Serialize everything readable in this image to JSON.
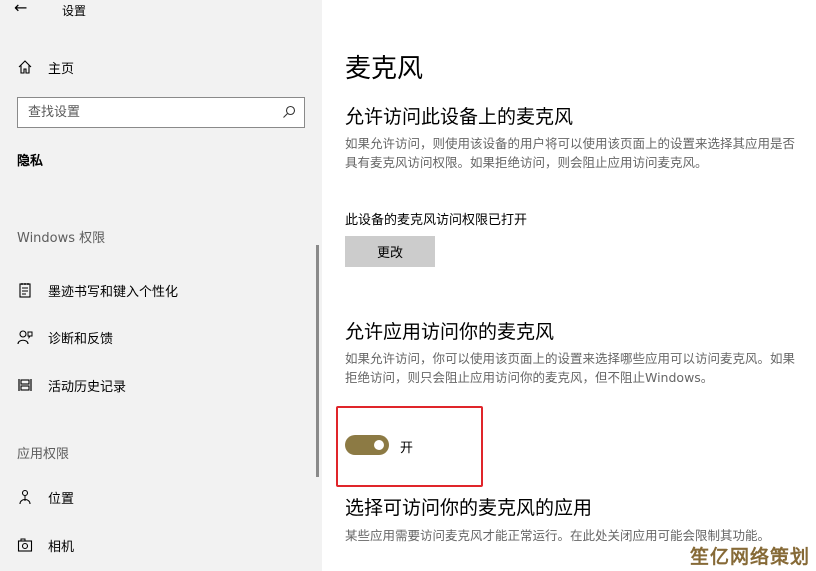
{
  "app": {
    "title": "设置"
  },
  "sidebar": {
    "home_label": "主页",
    "search_placeholder": "查找设置",
    "current_section": "隐私",
    "groups": [
      {
        "header": "Windows 权限",
        "items": [
          {
            "label": "墨迹书写和键入个性化",
            "icon": "notepad-icon"
          },
          {
            "label": "诊断和反馈",
            "icon": "person-feedback-icon"
          },
          {
            "label": "活动历史记录",
            "icon": "timeline-icon"
          }
        ]
      },
      {
        "header": "应用权限",
        "items": [
          {
            "label": "位置",
            "icon": "location-person-icon"
          },
          {
            "label": "相机",
            "icon": "camera-icon"
          }
        ]
      }
    ]
  },
  "main": {
    "title": "麦克风",
    "device_section": {
      "heading": "允许访问此设备上的麦克风",
      "description": "如果允许访问，则使用该设备的用户将可以使用该页面上的设置来选择其应用是否具有麦克风访问权限。如果拒绝访问，则会阻止应用访问麦克风。",
      "status": "此设备的麦克风访问权限已打开",
      "button_label": "更改"
    },
    "app_section": {
      "heading": "允许应用访问你的麦克风",
      "description": "如果允许访问，你可以使用该页面上的设置来选择哪些应用可以访问麦克风。如果拒绝访问，则只会阻止应用访问你的麦克风，但不阻止Windows。",
      "toggle_state": "开",
      "toggle_on": true
    },
    "choose_section": {
      "heading": "选择可访问你的麦克风的应用",
      "description": "某些应用需要访问麦克风才能正常运行。在此处关闭应用可能会限制其功能。"
    }
  },
  "watermark": "笙亿网络策划",
  "colors": {
    "accent": "#8c7a44",
    "highlight_border": "#e0252a",
    "sidebar_bg": "#f2f2f2"
  }
}
